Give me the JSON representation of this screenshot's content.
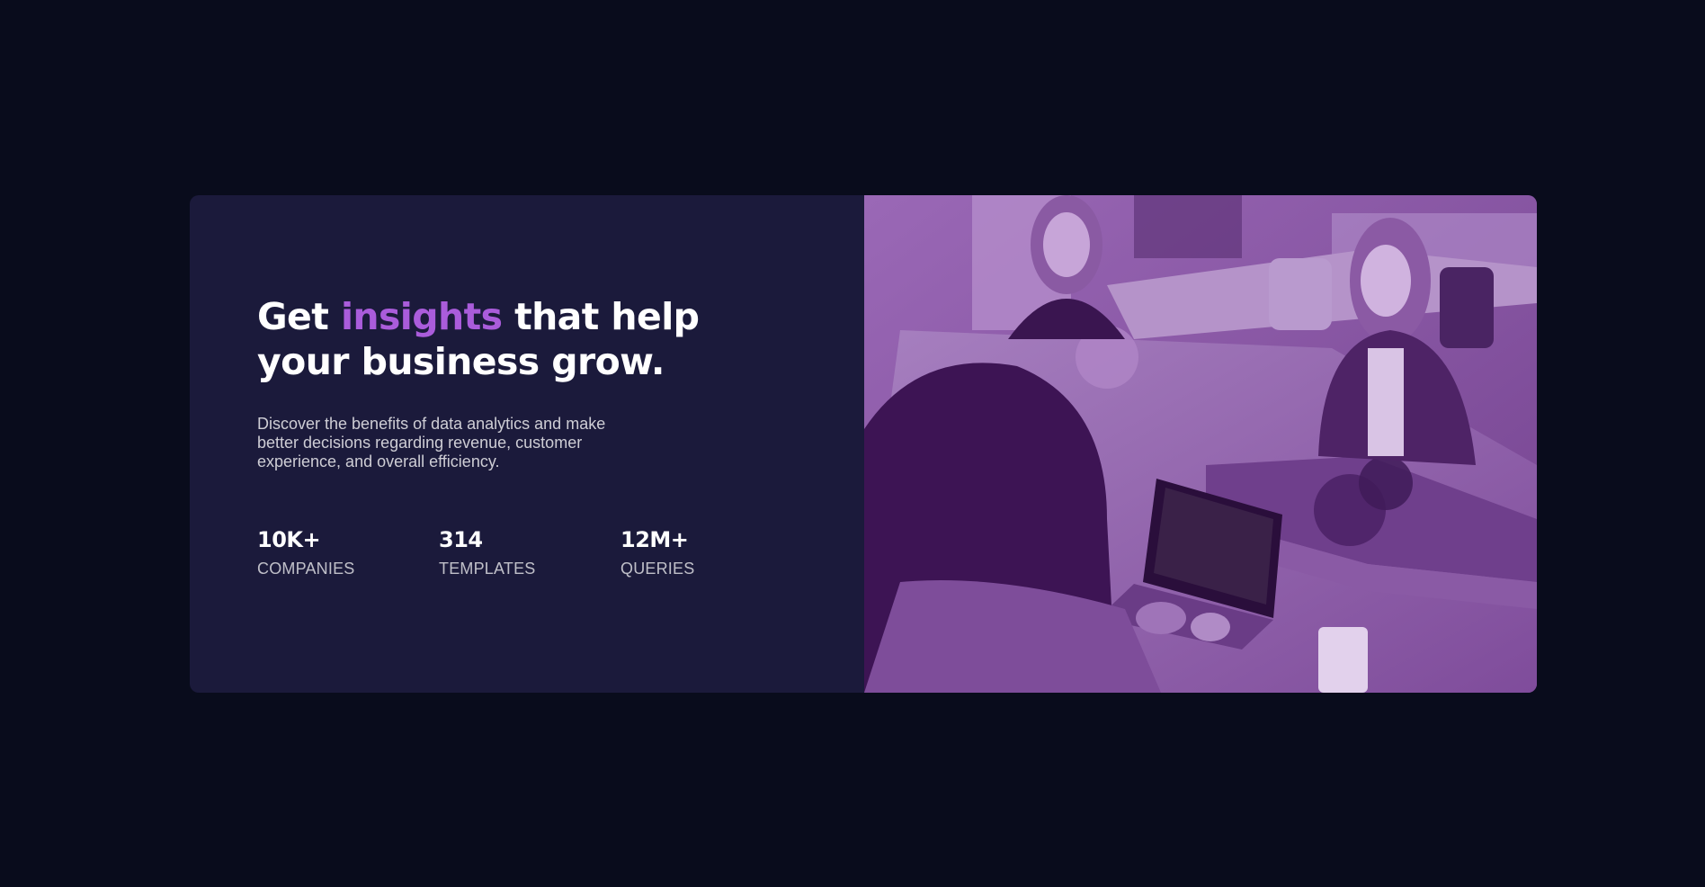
{
  "hero": {
    "headline_start": "Get ",
    "headline_accent": "insights",
    "headline_end": " that help your business grow.",
    "description": "Discover the benefits of data analytics and make better decisions regarding revenue, customer experience, and overall efficiency."
  },
  "stats": [
    {
      "value": "10K+",
      "label": "COMPANIES"
    },
    {
      "value": "314",
      "label": "TEMPLATES"
    },
    {
      "value": "12M+",
      "label": "QUERIES"
    }
  ],
  "image": {
    "subject": "people-working-at-office-table-photo",
    "tint_color": "#aa5cdb"
  },
  "colors": {
    "page_background": "#090c1c",
    "card_background": "#1b1a3b",
    "accent": "#aa5cdb",
    "text_primary": "#ffffff"
  }
}
